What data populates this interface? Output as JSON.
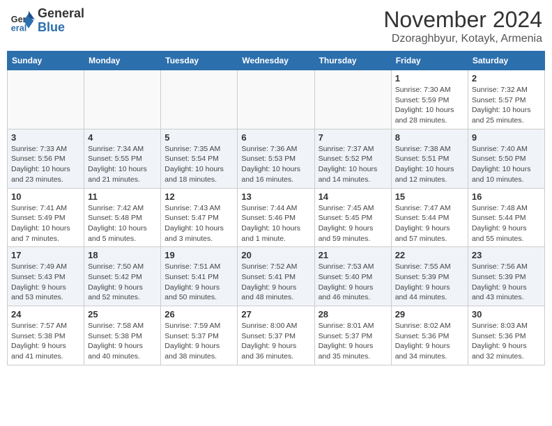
{
  "header": {
    "logo_general": "General",
    "logo_blue": "Blue",
    "month_title": "November 2024",
    "location": "Dzoraghbyur, Kotayk, Armenia"
  },
  "weekdays": [
    "Sunday",
    "Monday",
    "Tuesday",
    "Wednesday",
    "Thursday",
    "Friday",
    "Saturday"
  ],
  "weeks": [
    [
      {
        "day": "",
        "info": ""
      },
      {
        "day": "",
        "info": ""
      },
      {
        "day": "",
        "info": ""
      },
      {
        "day": "",
        "info": ""
      },
      {
        "day": "",
        "info": ""
      },
      {
        "day": "1",
        "info": "Sunrise: 7:30 AM\nSunset: 5:59 PM\nDaylight: 10 hours and 28 minutes."
      },
      {
        "day": "2",
        "info": "Sunrise: 7:32 AM\nSunset: 5:57 PM\nDaylight: 10 hours and 25 minutes."
      }
    ],
    [
      {
        "day": "3",
        "info": "Sunrise: 7:33 AM\nSunset: 5:56 PM\nDaylight: 10 hours and 23 minutes."
      },
      {
        "day": "4",
        "info": "Sunrise: 7:34 AM\nSunset: 5:55 PM\nDaylight: 10 hours and 21 minutes."
      },
      {
        "day": "5",
        "info": "Sunrise: 7:35 AM\nSunset: 5:54 PM\nDaylight: 10 hours and 18 minutes."
      },
      {
        "day": "6",
        "info": "Sunrise: 7:36 AM\nSunset: 5:53 PM\nDaylight: 10 hours and 16 minutes."
      },
      {
        "day": "7",
        "info": "Sunrise: 7:37 AM\nSunset: 5:52 PM\nDaylight: 10 hours and 14 minutes."
      },
      {
        "day": "8",
        "info": "Sunrise: 7:38 AM\nSunset: 5:51 PM\nDaylight: 10 hours and 12 minutes."
      },
      {
        "day": "9",
        "info": "Sunrise: 7:40 AM\nSunset: 5:50 PM\nDaylight: 10 hours and 10 minutes."
      }
    ],
    [
      {
        "day": "10",
        "info": "Sunrise: 7:41 AM\nSunset: 5:49 PM\nDaylight: 10 hours and 7 minutes."
      },
      {
        "day": "11",
        "info": "Sunrise: 7:42 AM\nSunset: 5:48 PM\nDaylight: 10 hours and 5 minutes."
      },
      {
        "day": "12",
        "info": "Sunrise: 7:43 AM\nSunset: 5:47 PM\nDaylight: 10 hours and 3 minutes."
      },
      {
        "day": "13",
        "info": "Sunrise: 7:44 AM\nSunset: 5:46 PM\nDaylight: 10 hours and 1 minute."
      },
      {
        "day": "14",
        "info": "Sunrise: 7:45 AM\nSunset: 5:45 PM\nDaylight: 9 hours and 59 minutes."
      },
      {
        "day": "15",
        "info": "Sunrise: 7:47 AM\nSunset: 5:44 PM\nDaylight: 9 hours and 57 minutes."
      },
      {
        "day": "16",
        "info": "Sunrise: 7:48 AM\nSunset: 5:44 PM\nDaylight: 9 hours and 55 minutes."
      }
    ],
    [
      {
        "day": "17",
        "info": "Sunrise: 7:49 AM\nSunset: 5:43 PM\nDaylight: 9 hours and 53 minutes."
      },
      {
        "day": "18",
        "info": "Sunrise: 7:50 AM\nSunset: 5:42 PM\nDaylight: 9 hours and 52 minutes."
      },
      {
        "day": "19",
        "info": "Sunrise: 7:51 AM\nSunset: 5:41 PM\nDaylight: 9 hours and 50 minutes."
      },
      {
        "day": "20",
        "info": "Sunrise: 7:52 AM\nSunset: 5:41 PM\nDaylight: 9 hours and 48 minutes."
      },
      {
        "day": "21",
        "info": "Sunrise: 7:53 AM\nSunset: 5:40 PM\nDaylight: 9 hours and 46 minutes."
      },
      {
        "day": "22",
        "info": "Sunrise: 7:55 AM\nSunset: 5:39 PM\nDaylight: 9 hours and 44 minutes."
      },
      {
        "day": "23",
        "info": "Sunrise: 7:56 AM\nSunset: 5:39 PM\nDaylight: 9 hours and 43 minutes."
      }
    ],
    [
      {
        "day": "24",
        "info": "Sunrise: 7:57 AM\nSunset: 5:38 PM\nDaylight: 9 hours and 41 minutes."
      },
      {
        "day": "25",
        "info": "Sunrise: 7:58 AM\nSunset: 5:38 PM\nDaylight: 9 hours and 40 minutes."
      },
      {
        "day": "26",
        "info": "Sunrise: 7:59 AM\nSunset: 5:37 PM\nDaylight: 9 hours and 38 minutes."
      },
      {
        "day": "27",
        "info": "Sunrise: 8:00 AM\nSunset: 5:37 PM\nDaylight: 9 hours and 36 minutes."
      },
      {
        "day": "28",
        "info": "Sunrise: 8:01 AM\nSunset: 5:37 PM\nDaylight: 9 hours and 35 minutes."
      },
      {
        "day": "29",
        "info": "Sunrise: 8:02 AM\nSunset: 5:36 PM\nDaylight: 9 hours and 34 minutes."
      },
      {
        "day": "30",
        "info": "Sunrise: 8:03 AM\nSunset: 5:36 PM\nDaylight: 9 hours and 32 minutes."
      }
    ]
  ]
}
